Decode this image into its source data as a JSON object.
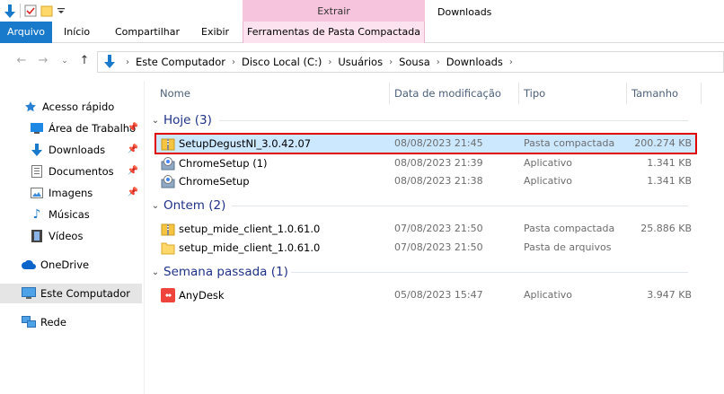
{
  "title_bar": {
    "context_tab_label": "Extrair",
    "window_title": "Downloads"
  },
  "ribbon": {
    "tabs": [
      "Arquivo",
      "Início",
      "Compartilhar",
      "Exibir",
      "Ferramentas de Pasta Compactada"
    ]
  },
  "address_bar": {
    "crumbs": [
      "Este Computador",
      "Disco Local (C:)",
      "Usuários",
      "Sousa",
      "Downloads"
    ]
  },
  "nav_pane": {
    "items": [
      {
        "label": "Acesso rápido",
        "icon": "star-icon"
      },
      {
        "label": "Área de Trabalho",
        "icon": "desktop-icon"
      },
      {
        "label": "Downloads",
        "icon": "download-arrow-icon"
      },
      {
        "label": "Documentos",
        "icon": "document-icon"
      },
      {
        "label": "Imagens",
        "icon": "image-icon"
      },
      {
        "label": "Músicas",
        "icon": "music-note-icon"
      },
      {
        "label": "Vídeos",
        "icon": "film-icon"
      },
      {
        "label": "OneDrive",
        "icon": "cloud-icon"
      },
      {
        "label": "Este Computador",
        "icon": "computer-icon"
      },
      {
        "label": "Rede",
        "icon": "network-icon"
      }
    ]
  },
  "file_list": {
    "columns": [
      "Nome",
      "Data de modificação",
      "Tipo",
      "Tamanho"
    ],
    "groups": [
      {
        "label": "Hoje (3)",
        "files": [
          {
            "name": "SetupDegustNI_3.0.42.07",
            "date": "08/08/2023 21:45",
            "type": "Pasta compactada",
            "size": "200.274 KB",
            "icon": "zip-folder-icon",
            "selected": true
          },
          {
            "name": "ChromeSetup (1)",
            "date": "08/08/2023 21:39",
            "type": "Aplicativo",
            "size": "1.341 KB",
            "icon": "installer-icon",
            "selected": false
          },
          {
            "name": "ChromeSetup",
            "date": "08/08/2023 21:38",
            "type": "Aplicativo",
            "size": "1.341 KB",
            "icon": "installer-icon",
            "selected": false
          }
        ]
      },
      {
        "label": "Ontem (2)",
        "files": [
          {
            "name": "setup_mide_client_1.0.61.0",
            "date": "07/08/2023 21:50",
            "type": "Pasta compactada",
            "size": "25.886 KB",
            "icon": "zip-folder-icon",
            "selected": false
          },
          {
            "name": "setup_mide_client_1.0.61.0",
            "date": "07/08/2023 21:50",
            "type": "Pasta de arquivos",
            "size": "",
            "icon": "folder-icon",
            "selected": false
          }
        ]
      },
      {
        "label": "Semana passada (1)",
        "files": [
          {
            "name": "AnyDesk",
            "date": "05/08/2023 15:47",
            "type": "Aplicativo",
            "size": "3.947 KB",
            "icon": "anydesk-icon",
            "selected": false
          }
        ]
      }
    ]
  },
  "colors": {
    "file_tab": "#1979ca",
    "context_tab": "#f6c4dd",
    "group_header": "#1e3287",
    "selection_fill": "#cce8ff",
    "highlight_border": "#e00000"
  }
}
